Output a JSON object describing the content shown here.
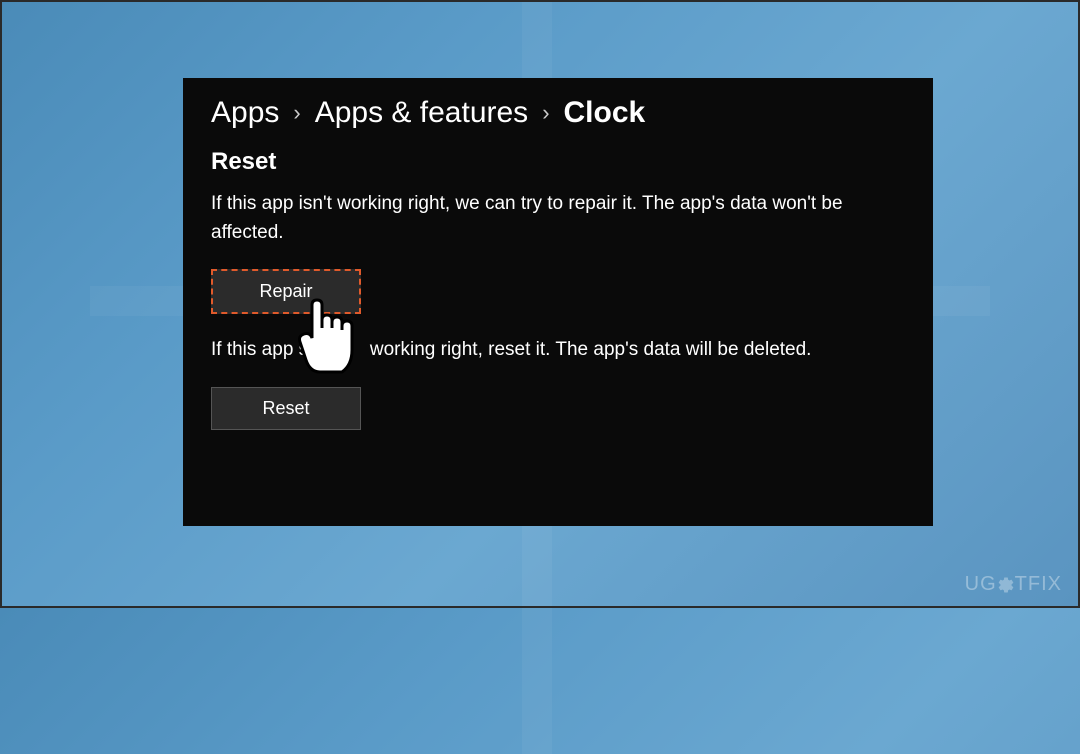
{
  "breadcrumb": {
    "level1": "Apps",
    "level2": "Apps & features",
    "level3": "Clock"
  },
  "section": {
    "title": "Reset",
    "repair_desc": "If this app isn't working right, we can try to repair it. The app's data won't be affected.",
    "repair_button": "Repair",
    "reset_desc_pre": "If this app s",
    "reset_desc_post": "working right, reset it. The app's data will be deleted.",
    "reset_button": "Reset"
  },
  "watermark": {
    "text_left": "UG",
    "text_right": "TFIX"
  }
}
